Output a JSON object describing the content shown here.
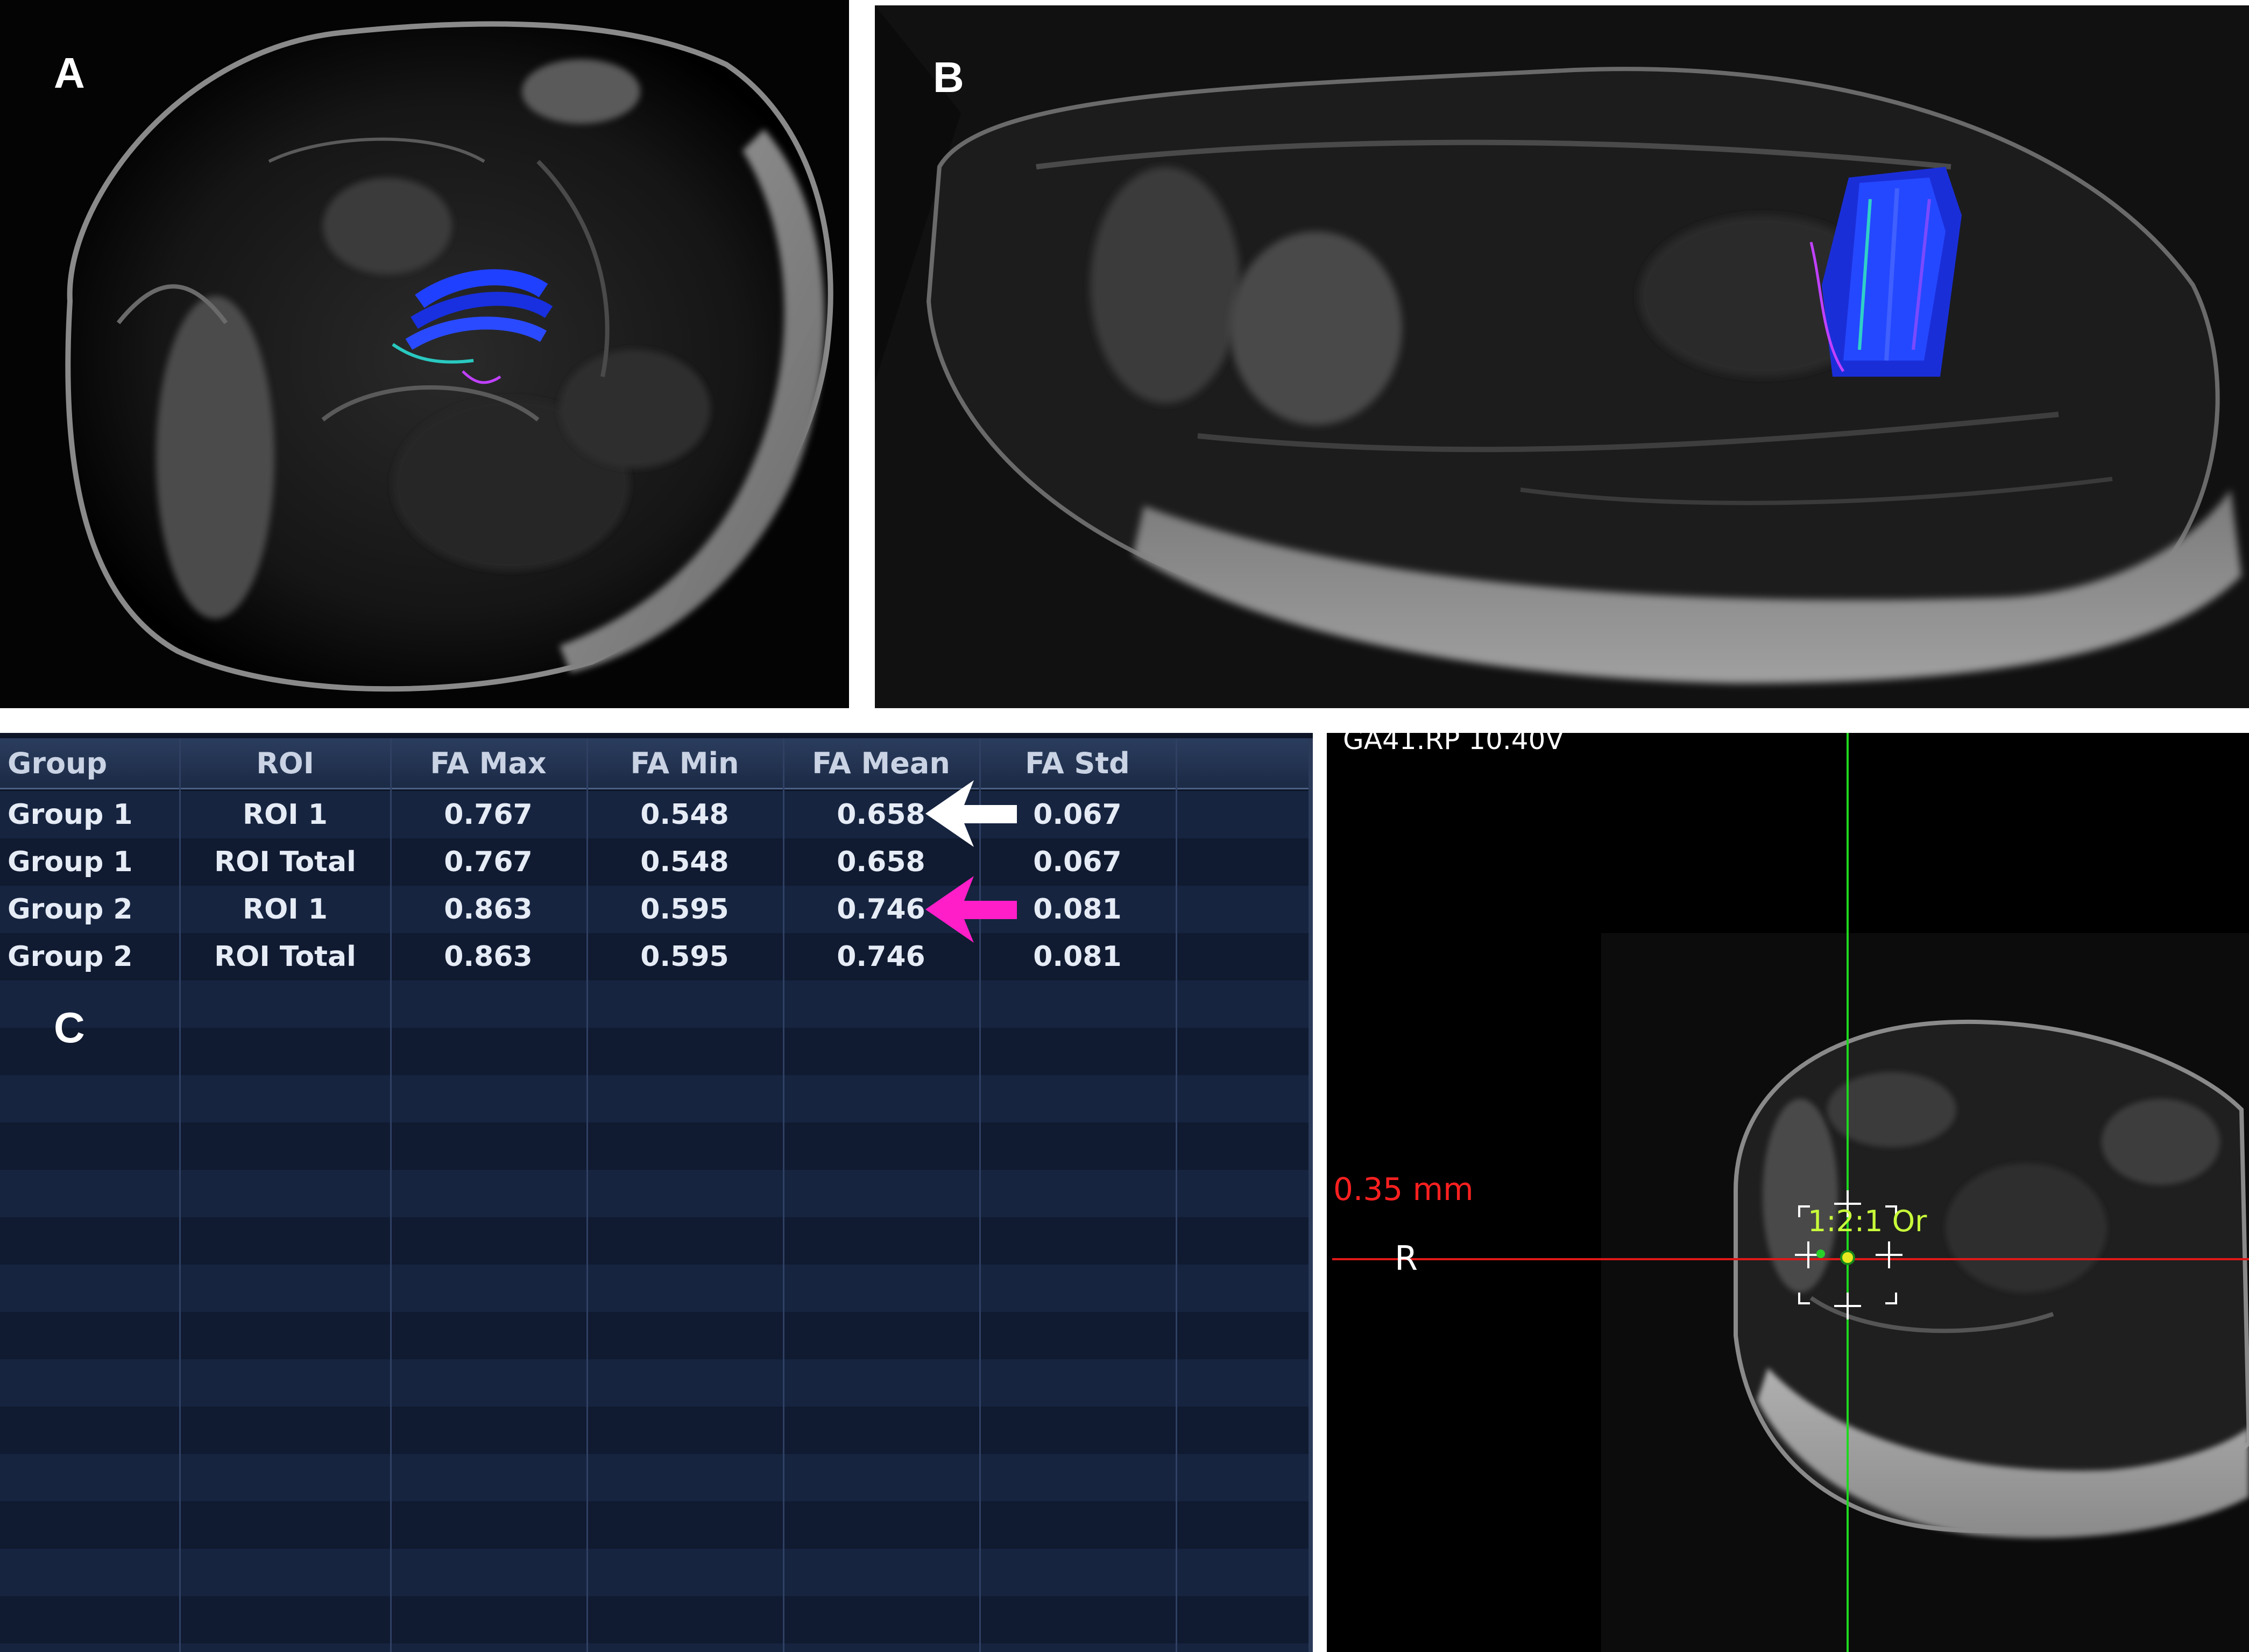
{
  "panels": {
    "a": {
      "letter": "A"
    },
    "b": {
      "letter": "B"
    },
    "c": {
      "letter": "C"
    }
  },
  "table": {
    "columns": [
      "Group",
      "ROI",
      "FA Max",
      "FA Min",
      "FA Mean",
      "FA Std"
    ],
    "rows": [
      [
        "Group 1",
        "ROI 1",
        "0.767",
        "0.548",
        "0.658",
        "0.067"
      ],
      [
        "Group 1",
        "ROI Total",
        "0.767",
        "0.548",
        "0.658",
        "0.067"
      ],
      [
        "Group 2",
        "ROI 1",
        "0.863",
        "0.595",
        "0.746",
        "0.081"
      ],
      [
        "Group 2",
        "ROI Total",
        "0.863",
        "0.595",
        "0.746",
        "0.081"
      ]
    ],
    "arrow_colors": {
      "row1": "#ffffff",
      "row3": "#ff1ec8"
    }
  },
  "viewer": {
    "top_text": "GA41.RP 10.40V",
    "distance": "0.35",
    "distance_unit": "mm",
    "orientation": "R",
    "roi_label": "1:2:1 Or",
    "crosshair_colors": {
      "vertical": "#1ed81e",
      "horizontal": "#e01818"
    }
  }
}
